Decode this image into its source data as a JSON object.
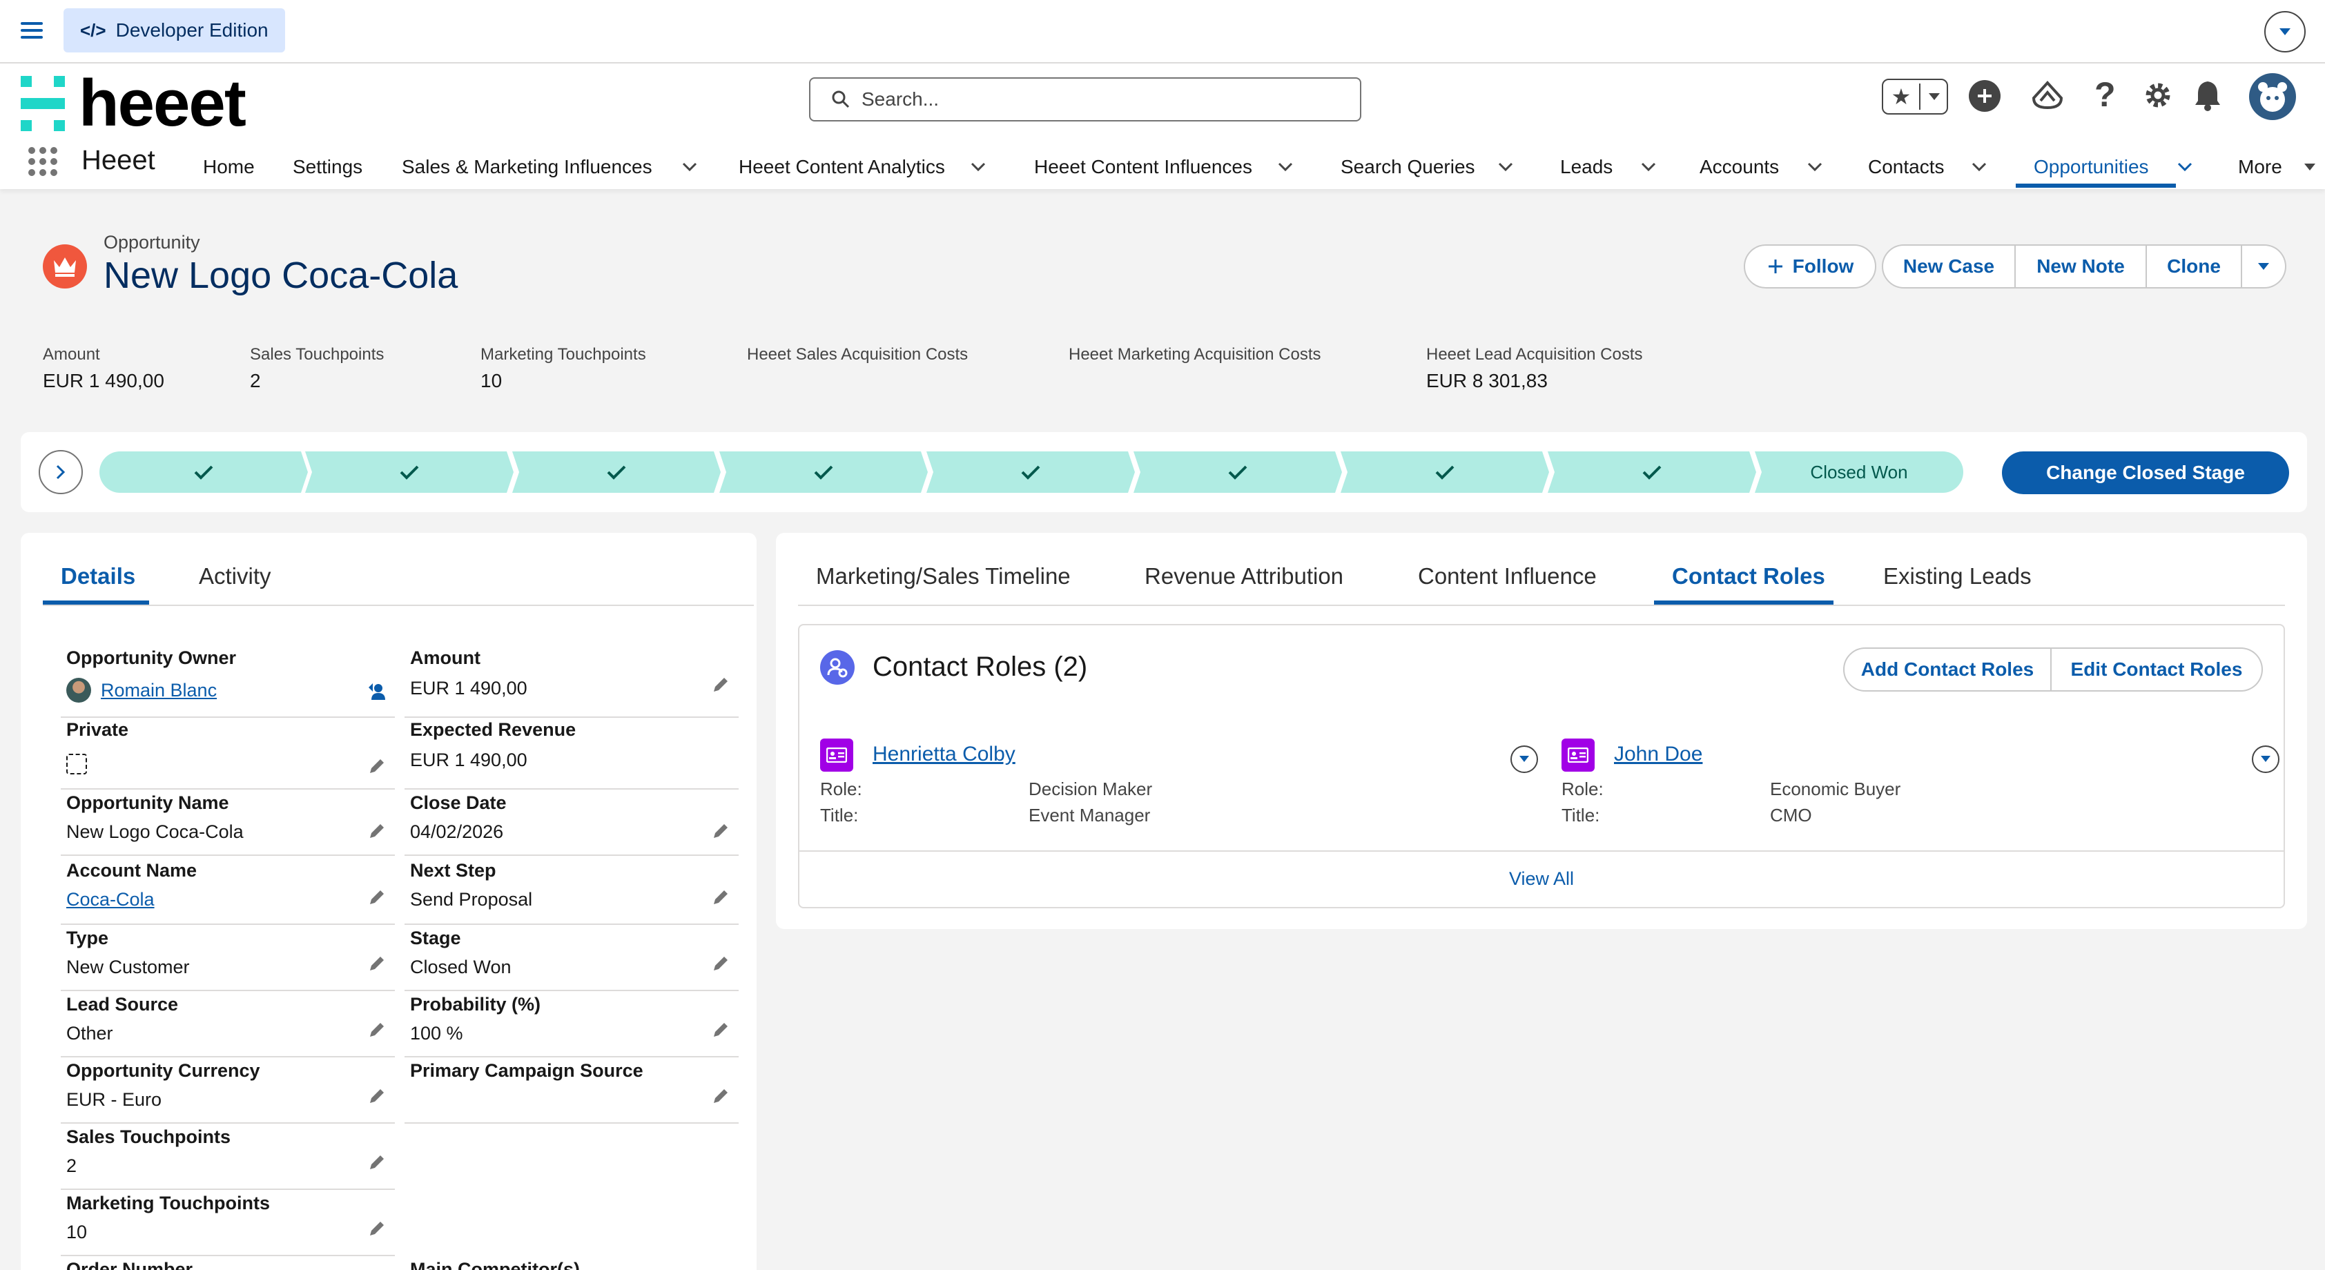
{
  "utility": {
    "dev_edition": "Developer Edition"
  },
  "header": {
    "logo_text": "heeet",
    "search_placeholder": "Search...",
    "app_name": "Heeet",
    "nav": [
      {
        "label": "Home",
        "dropdown": false
      },
      {
        "label": "Settings",
        "dropdown": false
      },
      {
        "label": "Sales & Marketing Influences",
        "dropdown": true
      },
      {
        "label": "Heeet Content Analytics",
        "dropdown": true
      },
      {
        "label": "Heeet Content Influences",
        "dropdown": true
      },
      {
        "label": "Search Queries",
        "dropdown": true
      },
      {
        "label": "Leads",
        "dropdown": true
      },
      {
        "label": "Accounts",
        "dropdown": true
      },
      {
        "label": "Contacts",
        "dropdown": true
      },
      {
        "label": "Opportunities",
        "dropdown": true,
        "active": true
      },
      {
        "label": "More",
        "dropdown": true
      }
    ]
  },
  "record": {
    "object_label": "Opportunity",
    "title": "New Logo Coca-Cola",
    "actions": {
      "follow": "Follow",
      "new_case": "New Case",
      "new_note": "New Note",
      "clone": "Clone"
    },
    "highlights": [
      {
        "label": "Amount",
        "value": "EUR 1 490,00"
      },
      {
        "label": "Sales Touchpoints",
        "value": "2"
      },
      {
        "label": "Marketing Touchpoints",
        "value": "10"
      },
      {
        "label": "Heeet Sales Acquisition Costs",
        "value": ""
      },
      {
        "label": "Heeet Marketing Acquisition Costs",
        "value": ""
      },
      {
        "label": "Heeet Lead Acquisition Costs",
        "value": "EUR 8 301,83"
      }
    ]
  },
  "path": {
    "completed_stages": 8,
    "current_stage": "Closed Won",
    "change_button": "Change Closed Stage"
  },
  "details": {
    "tabs": [
      {
        "label": "Details",
        "active": true
      },
      {
        "label": "Activity"
      }
    ],
    "left_fields": [
      {
        "label": "Opportunity Owner",
        "value": "Romain Blanc",
        "link": true,
        "avatar": true,
        "change_owner": true
      },
      {
        "label": "Private",
        "value": "",
        "checkbox": true
      },
      {
        "label": "Opportunity Name",
        "value": "New Logo Coca-Cola"
      },
      {
        "label": "Account Name",
        "value": "Coca-Cola",
        "link": true
      },
      {
        "label": "Type",
        "value": "New Customer"
      },
      {
        "label": "Lead Source",
        "value": "Other"
      },
      {
        "label": "Opportunity Currency",
        "value": "EUR - Euro"
      },
      {
        "label": "Sales Touchpoints",
        "value": "2"
      },
      {
        "label": "Marketing Touchpoints",
        "value": "10"
      },
      {
        "label": "Order Number",
        "value": ""
      }
    ],
    "right_fields": [
      {
        "label": "Amount",
        "value": "EUR 1 490,00"
      },
      {
        "label": "Expected Revenue",
        "value": "EUR 1 490,00",
        "readonly": true
      },
      {
        "label": "Close Date",
        "value": "04/02/2026"
      },
      {
        "label": "Next Step",
        "value": "Send Proposal"
      },
      {
        "label": "Stage",
        "value": "Closed Won"
      },
      {
        "label": "Probability (%)",
        "value": "100 %"
      },
      {
        "label": "Primary Campaign Source",
        "value": ""
      },
      {
        "label": "Main Competitor(s)",
        "value": ""
      }
    ]
  },
  "related": {
    "tabs": [
      {
        "label": "Marketing/Sales Timeline"
      },
      {
        "label": "Revenue Attribution"
      },
      {
        "label": "Content Influence"
      },
      {
        "label": "Contact Roles",
        "active": true
      },
      {
        "label": "Existing Leads"
      }
    ],
    "contact_roles": {
      "title": "Contact Roles (2)",
      "add_button": "Add Contact Roles",
      "edit_button": "Edit Contact Roles",
      "role_label": "Role:",
      "title_label": "Title:",
      "contacts": [
        {
          "name": "Henrietta Colby",
          "role": "Decision Maker",
          "title": "Event Manager"
        },
        {
          "name": "John Doe",
          "role": "Economic Buyer",
          "title": "CMO"
        }
      ],
      "view_all": "View All"
    }
  },
  "colors": {
    "brand_blue": "#0b5cab",
    "path_complete": "#b0ece3",
    "record_icon": "#f0573d",
    "contact_icon": "#a100e6"
  }
}
